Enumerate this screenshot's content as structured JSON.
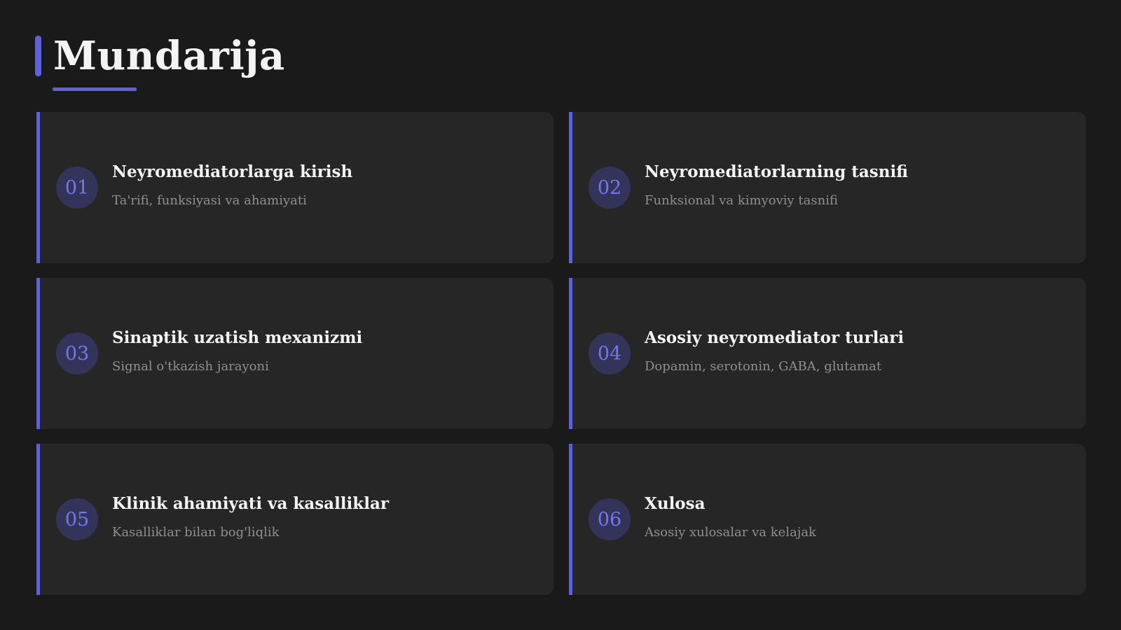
{
  "page": {
    "title": "Mundarija"
  },
  "colors": {
    "background": "#1a1a1b",
    "card": "#262627",
    "accent": "#6161d6",
    "badge_bg": "#34345a",
    "badge_text": "#7476f0"
  },
  "items": [
    {
      "number": "01",
      "title": "Neyromediatorlarga kirish",
      "subtitle": "Ta'rifi, funksiyasi va ahamiyati"
    },
    {
      "number": "02",
      "title": "Neyromediatorlarning tasnifi",
      "subtitle": "Funksional va kimyoviy tasnifi"
    },
    {
      "number": "03",
      "title": "Sinaptik uzatish mexanizmi",
      "subtitle": "Signal o'tkazish jarayoni"
    },
    {
      "number": "04",
      "title": "Asosiy neyromediator turlari",
      "subtitle": "Dopamin, serotonin, GABA, glutamat"
    },
    {
      "number": "05",
      "title": "Klinik ahamiyati va kasalliklar",
      "subtitle": "Kasalliklar bilan bog'liqlik"
    },
    {
      "number": "06",
      "title": "Xulosa",
      "subtitle": "Asosiy xulosalar va kelajak"
    }
  ]
}
